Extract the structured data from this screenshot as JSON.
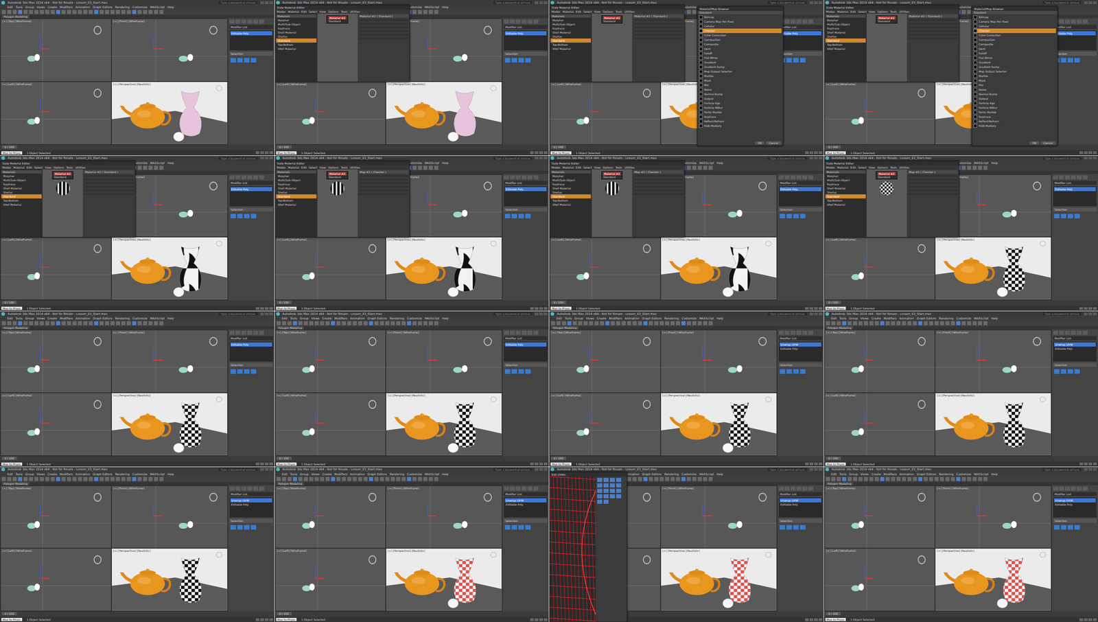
{
  "app_title": "Autodesk 3ds Max 2014 x64 - Not for Resale - Lesson_03_Start.max",
  "search_placeholder": "Type a keyword or phrase",
  "menu": [
    "Edit",
    "Tools",
    "Group",
    "Views",
    "Create",
    "Modifiers",
    "Animation",
    "Graph Editors",
    "Rendering",
    "Customize",
    "MAXScript",
    "Help"
  ],
  "ribbon_label": "Polygon Modeling",
  "viewports": [
    "[+] [Top] [Wireframe]",
    "[+] [Front] [Wireframe]",
    "[+] [Left] [Wireframe]",
    "[+] [Perspective] [Realistic]"
  ],
  "command_panel": {
    "modifier_list": "Modifier List",
    "rollout": "Selection"
  },
  "status": {
    "prompt": "Max to Physc",
    "selection": "1 Object Selected",
    "frame": "0 / 100"
  },
  "material_editor": {
    "title": "Slate Material Editor",
    "menu": [
      "Modes",
      "Material",
      "Edit",
      "Select",
      "View",
      "Options",
      "Tools",
      "Utilities"
    ],
    "group": "Materials",
    "materials": [
      {
        "label": "Morpher",
        "selected": false
      },
      {
        "label": "Multi/Sub-Object",
        "selected": false
      },
      {
        "label": "Raytrace",
        "selected": false
      },
      {
        "label": "Shell Material",
        "selected": false
      },
      {
        "label": "Shellac",
        "selected": false
      },
      {
        "label": "Standard",
        "selected": true
      },
      {
        "label": "Top/Bottom",
        "selected": false
      },
      {
        "label": "XRef Material",
        "selected": false
      }
    ],
    "node": "Material #2",
    "node_type": "Standard"
  },
  "map_browser": {
    "title": "Material/Map Browser",
    "group": "Standard",
    "items": [
      {
        "label": "Bitmap",
        "selected": false
      },
      {
        "label": "Camera Map Per Pixel",
        "selected": false
      },
      {
        "label": "Cellular",
        "selected": false
      },
      {
        "label": "Checker",
        "selected": true
      },
      {
        "label": "Color Correction",
        "selected": false
      },
      {
        "label": "Combustion",
        "selected": false
      },
      {
        "label": "Composite",
        "selected": false
      },
      {
        "label": "Dent",
        "selected": false
      },
      {
        "label": "Falloff",
        "selected": false
      },
      {
        "label": "Flat Mirror",
        "selected": false
      },
      {
        "label": "Gradient",
        "selected": false
      },
      {
        "label": "Gradient Ramp",
        "selected": false
      },
      {
        "label": "Map Output Selector",
        "selected": false
      },
      {
        "label": "Marble",
        "selected": false
      },
      {
        "label": "Mask",
        "selected": false
      },
      {
        "label": "Mix",
        "selected": false
      },
      {
        "label": "Noise",
        "selected": false
      },
      {
        "label": "Normal Bump",
        "selected": false
      },
      {
        "label": "Output",
        "selected": false
      },
      {
        "label": "Particle Age",
        "selected": false
      },
      {
        "label": "Particle MBlur",
        "selected": false
      },
      {
        "label": "Perlin Marble",
        "selected": false
      },
      {
        "label": "Raytrace",
        "selected": false
      },
      {
        "label": "Reflect/Refract",
        "selected": false
      },
      {
        "label": "RGB Multiply",
        "selected": false
      }
    ],
    "buttons": [
      "OK",
      "Cancel"
    ]
  },
  "uv_editor": {
    "title": "Edit UVWs"
  },
  "frames": [
    {
      "vase": "solid",
      "colors": [
        "#e6c4dc",
        "#e6c4dc"
      ],
      "ball": true,
      "stack": [
        {
          "label": "Editable Poly",
          "selected": true
        }
      ],
      "dialogs": []
    },
    {
      "vase": "solid",
      "colors": [
        "#e6c4dc",
        "#e6c4dc"
      ],
      "ball": true,
      "stack": [
        {
          "label": "Editable Poly",
          "selected": true
        }
      ],
      "dialogs": [
        {
          "kind": "material-editor",
          "preview": "none",
          "params": "Material #2 ( Standard )"
        }
      ]
    },
    {
      "vase": "solid",
      "colors": [
        "#e6c4dc",
        "#e6c4dc"
      ],
      "ball": true,
      "stack": [
        {
          "label": "Editable Poly",
          "selected": true
        }
      ],
      "dialogs": [
        {
          "kind": "material-editor",
          "preview": "none",
          "params": "Material #2 ( Standard )"
        },
        {
          "kind": "map-browser"
        }
      ]
    },
    {
      "vase": "solid",
      "colors": [
        "#e6c4dc",
        "#e6c4dc"
      ],
      "ball": true,
      "stack": [
        {
          "label": "Editable Poly",
          "selected": true
        }
      ],
      "dialogs": [
        {
          "kind": "material-editor",
          "preview": "none",
          "params": "Material #2 ( Standard )"
        },
        {
          "kind": "map-browser"
        }
      ]
    },
    {
      "vase": "blotch",
      "colors": [
        "#111111",
        "#f2f2f2"
      ],
      "ball": true,
      "stack": [
        {
          "label": "Editable Poly",
          "selected": true
        }
      ],
      "dialogs": [
        {
          "kind": "material-editor",
          "preview": "blotch",
          "params": "Material #2 ( Standard )"
        }
      ]
    },
    {
      "vase": "blotch",
      "colors": [
        "#111111",
        "#f2f2f2"
      ],
      "ball": true,
      "stack": [
        {
          "label": "Editable Poly",
          "selected": true
        }
      ],
      "dialogs": [
        {
          "kind": "material-editor",
          "preview": "blotch",
          "params": "Map #1 ( Checker )"
        }
      ]
    },
    {
      "vase": "blotch",
      "colors": [
        "#111111",
        "#f2f2f2"
      ],
      "ball": true,
      "stack": [
        {
          "label": "Editable Poly",
          "selected": true
        }
      ],
      "dialogs": [
        {
          "kind": "material-editor",
          "preview": "blotch",
          "params": "Map #1 ( Checker )"
        }
      ]
    },
    {
      "vase": "checker",
      "colors": [
        "#111111",
        "#f2f2f2"
      ],
      "ball": true,
      "stack": [
        {
          "label": "Editable Poly",
          "selected": true
        }
      ],
      "dialogs": [
        {
          "kind": "material-editor",
          "preview": "checker",
          "params": "Map #1 ( Checker )"
        }
      ]
    },
    {
      "vase": "checker",
      "colors": [
        "#111111",
        "#f2f2f2"
      ],
      "ball": true,
      "stack": [
        {
          "label": "Editable Poly",
          "selected": true
        }
      ],
      "dialogs": []
    },
    {
      "vase": "checker",
      "colors": [
        "#111111",
        "#f2f2f2"
      ],
      "ball": true,
      "stack": [
        {
          "label": "Editable Poly",
          "selected": true
        }
      ],
      "dialogs": []
    },
    {
      "vase": "checker",
      "colors": [
        "#111111",
        "#f2f2f2"
      ],
      "ball": true,
      "stack": [
        {
          "label": "Unwrap UVW",
          "selected": true
        },
        {
          "label": "Editable Poly",
          "selected": false
        }
      ],
      "dialogs": []
    },
    {
      "vase": "checker",
      "colors": [
        "#111111",
        "#f2f2f2"
      ],
      "ball": false,
      "stack": [
        {
          "label": "Unwrap UVW",
          "selected": true
        },
        {
          "label": "Editable Poly",
          "selected": false
        }
      ],
      "dialogs": []
    },
    {
      "vase": "checker",
      "colors": [
        "#111111",
        "#f2f2f2"
      ],
      "ball": false,
      "stack": [
        {
          "label": "Unwrap UVW",
          "selected": true
        },
        {
          "label": "Editable Poly",
          "selected": false
        }
      ],
      "dialogs": []
    },
    {
      "vase": "checker",
      "colors": [
        "#d9534f",
        "#f4f4f4"
      ],
      "ball": true,
      "stack": [
        {
          "label": "Unwrap UVW",
          "selected": true
        },
        {
          "label": "Editable Poly",
          "selected": false
        }
      ],
      "dialogs": []
    },
    {
      "vase": "checker",
      "colors": [
        "#d9534f",
        "#f4f4f4"
      ],
      "ball": true,
      "stack": [
        {
          "label": "Unwrap UVW",
          "selected": true
        },
        {
          "label": "Editable Poly",
          "selected": false
        }
      ],
      "dialogs": [
        {
          "kind": "uv-editor"
        }
      ]
    },
    {
      "vase": "checker",
      "colors": [
        "#d9534f",
        "#f4f4f4"
      ],
      "ball": true,
      "stack": [
        {
          "label": "Unwrap UVW",
          "selected": true
        },
        {
          "label": "Editable Poly",
          "selected": false
        }
      ],
      "dialogs": []
    }
  ]
}
